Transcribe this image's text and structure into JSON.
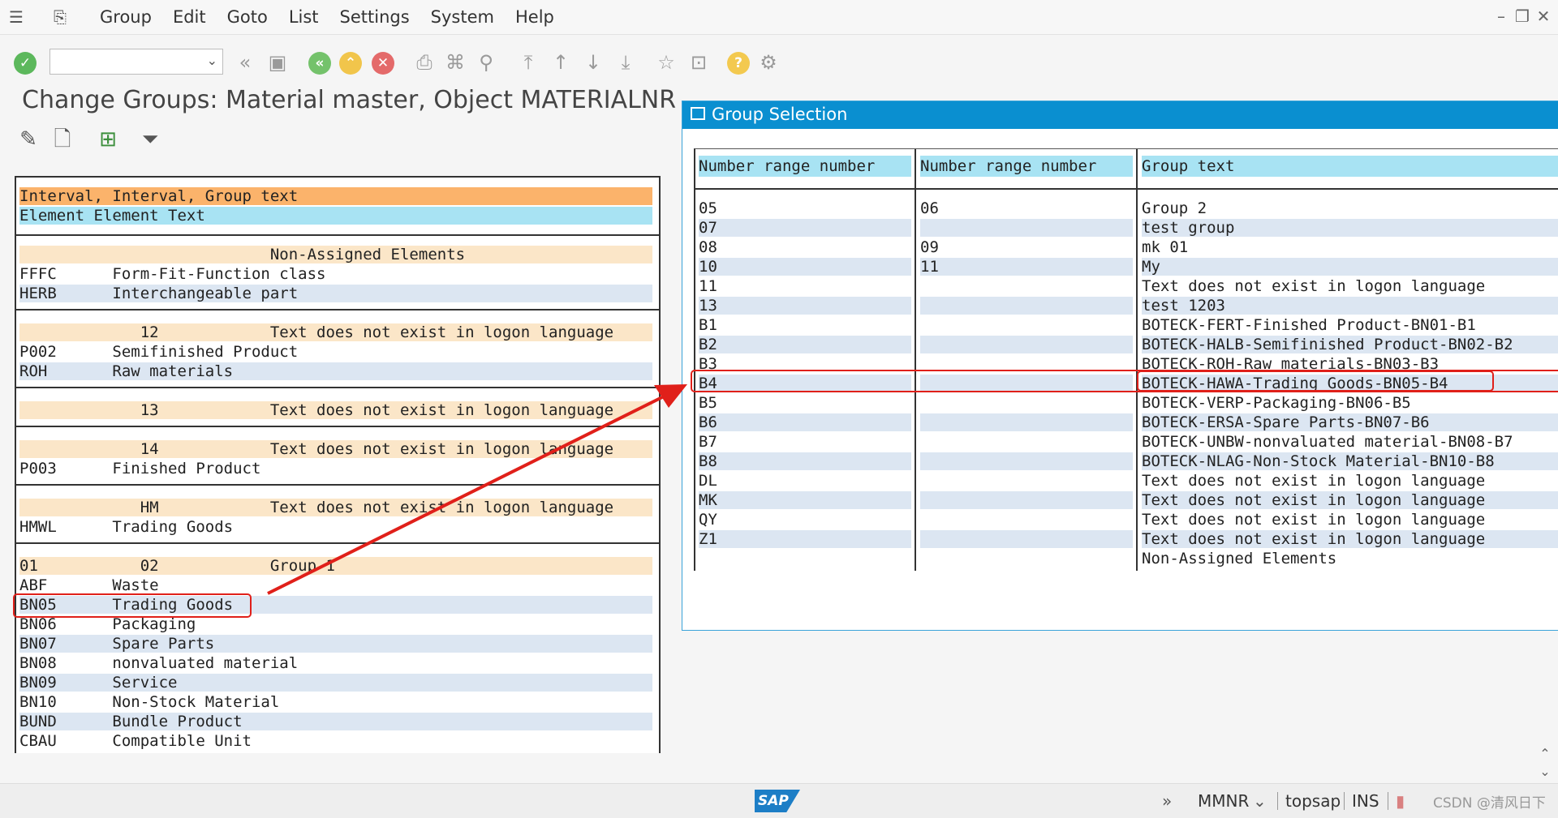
{
  "menu": {
    "items": [
      "Group",
      "Edit",
      "Goto",
      "List",
      "Settings",
      "System",
      "Help"
    ]
  },
  "toolbar": {
    "command_field_value": "",
    "icons": [
      "enter-icon",
      "back-icon",
      "save-icon",
      "previous-icon",
      "exit-icon",
      "cancel-icon",
      "print-icon",
      "find-icon",
      "find-next-icon",
      "first-page-icon",
      "previous-page-icon",
      "next-page-icon",
      "last-page-icon",
      "create-session-icon",
      "shortcut-icon",
      "help-icon",
      "customize-layout-icon"
    ]
  },
  "page": {
    "title": "Change Groups: Material master, Object MATERIALNR"
  },
  "app_toolbar": [
    "edit-icon",
    "new-document-icon",
    "hierarchy-icon",
    "filter-icon"
  ],
  "left_list": {
    "header_line1": "Interval, Interval, Group text",
    "header_line2": "Element Element Text",
    "rows": [
      {
        "text": "                           Non-Assigned Elements",
        "style": "grp"
      },
      {
        "text": "FFFC      Form-Fit-Function class",
        "style": ""
      },
      {
        "text": "HERB      Interchangeable part",
        "style": "alt"
      },
      {
        "text": "             12            Text does not exist in logon language",
        "style": "grp"
      },
      {
        "text": "P002      Semifinished Product",
        "style": ""
      },
      {
        "text": "ROH       Raw materials",
        "style": "alt"
      },
      {
        "text": "             13            Text does not exist in logon language",
        "style": "grp"
      },
      {
        "text": "             14            Text does not exist in logon language",
        "style": "grp"
      },
      {
        "text": "P003      Finished Product",
        "style": ""
      },
      {
        "text": "             HM            Text does not exist in logon language",
        "style": "grp"
      },
      {
        "text": "HMWL      Trading Goods",
        "style": ""
      },
      {
        "text": "01           02            Group 1",
        "style": "grp"
      },
      {
        "text": "ABF       Waste",
        "style": ""
      },
      {
        "text": "BN05      Trading Goods",
        "style": "alt"
      },
      {
        "text": "BN06      Packaging",
        "style": ""
      },
      {
        "text": "BN07      Spare Parts",
        "style": "alt"
      },
      {
        "text": "BN08      nonvaluated material",
        "style": ""
      },
      {
        "text": "BN09      Service",
        "style": "alt"
      },
      {
        "text": "BN10      Non-Stock Material",
        "style": ""
      },
      {
        "text": "BUND      Bundle Product",
        "style": "alt"
      },
      {
        "text": "CBAU      Compatible Unit",
        "style": ""
      }
    ]
  },
  "dialog": {
    "title": "Group Selection",
    "columns": [
      "Number range number",
      "Number range number",
      "Group text"
    ],
    "rows": [
      [
        "05",
        "06",
        "Group 2"
      ],
      [
        "07",
        "",
        "test group"
      ],
      [
        "08",
        "09",
        "mk 01"
      ],
      [
        "10",
        "11",
        "My"
      ],
      [
        "11",
        "",
        "Text does not exist in logon language"
      ],
      [
        "13",
        "",
        "test 1203"
      ],
      [
        "B1",
        "",
        "BOTECK-FERT-Finished Product-BN01-B1"
      ],
      [
        "B2",
        "",
        "BOTECK-HALB-Semifinished Product-BN02-B2"
      ],
      [
        "B3",
        "",
        "BOTECK-ROH-Raw materials-BN03-B3"
      ],
      [
        "B4",
        "",
        "BOTECK-HAWA-Trading Goods-BN05-B4"
      ],
      [
        "B5",
        "",
        "BOTECK-VERP-Packaging-BN06-B5"
      ],
      [
        "B6",
        "",
        "BOTECK-ERSA-Spare Parts-BN07-B6"
      ],
      [
        "B7",
        "",
        "BOTECK-UNBW-nonvaluated material-BN08-B7"
      ],
      [
        "B8",
        "",
        "BOTECK-NLAG-Non-Stock Material-BN10-B8"
      ],
      [
        "DL",
        "",
        "Text does not exist in logon language"
      ],
      [
        "MK",
        "",
        "Text does not exist in logon language"
      ],
      [
        "QY",
        "",
        "Text does not exist in logon language"
      ],
      [
        "Z1",
        "",
        "Text does not exist in logon language"
      ],
      [
        "",
        "",
        "Non-Assigned Elements"
      ]
    ]
  },
  "statusbar": {
    "logo": "SAP",
    "transaction": "MMNR",
    "system": "topsap",
    "mode": "INS",
    "watermark": "CSDN @清风日下"
  },
  "colors": {
    "dialog_title_bg": "#0a8fd0",
    "header_orange": "#fbb36b",
    "header_cyan": "#a8e3f3",
    "group_row": "#fbe6c8",
    "alt_row": "#dce6f2",
    "annotation_red": "#e0201a"
  }
}
